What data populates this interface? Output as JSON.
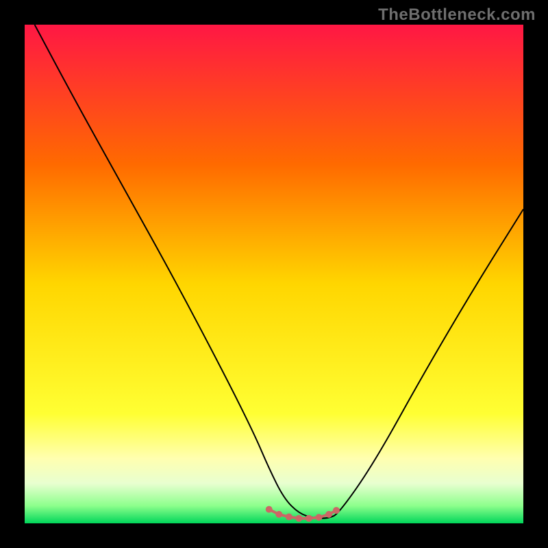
{
  "watermark": {
    "text": "TheBottleneck.com"
  },
  "colors": {
    "black": "#000000",
    "curve": "#000000",
    "marker": "#cc6666",
    "gradient_top": "#ff1744",
    "gradient_mid_upper": "#ff8a00",
    "gradient_mid": "#ffe600",
    "gradient_mid_lower": "#ffff66",
    "gradient_lower": "#f2ffcc",
    "gradient_bottom": "#00e676"
  },
  "chart_data": {
    "type": "line",
    "title": "",
    "xlabel": "",
    "ylabel": "",
    "xlim": [
      0,
      100
    ],
    "ylim": [
      0,
      100
    ],
    "series": [
      {
        "name": "bottleneck-curve",
        "x": [
          2,
          10,
          20,
          30,
          40,
          46,
          49,
          52,
          55,
          58,
          61,
          63,
          70,
          80,
          90,
          100
        ],
        "values": [
          100,
          85,
          67,
          49,
          30,
          18,
          11,
          5,
          2,
          1,
          1,
          2,
          12,
          30,
          47,
          63
        ]
      }
    ],
    "annotations": [
      {
        "name": "flat-segment-markers",
        "x": [
          49,
          51,
          53,
          55,
          57,
          59,
          61,
          62.5
        ],
        "values": [
          2.8,
          1.8,
          1.3,
          1.0,
          1.0,
          1.2,
          1.8,
          2.6
        ]
      }
    ],
    "background_gradient_stops": [
      {
        "offset": 0.0,
        "color": "#ff1744"
      },
      {
        "offset": 0.28,
        "color": "#ff6a00"
      },
      {
        "offset": 0.52,
        "color": "#ffd600"
      },
      {
        "offset": 0.78,
        "color": "#ffff33"
      },
      {
        "offset": 0.87,
        "color": "#ffffb0"
      },
      {
        "offset": 0.92,
        "color": "#e8ffd0"
      },
      {
        "offset": 0.965,
        "color": "#8cff8c"
      },
      {
        "offset": 1.0,
        "color": "#00d65a"
      }
    ]
  }
}
